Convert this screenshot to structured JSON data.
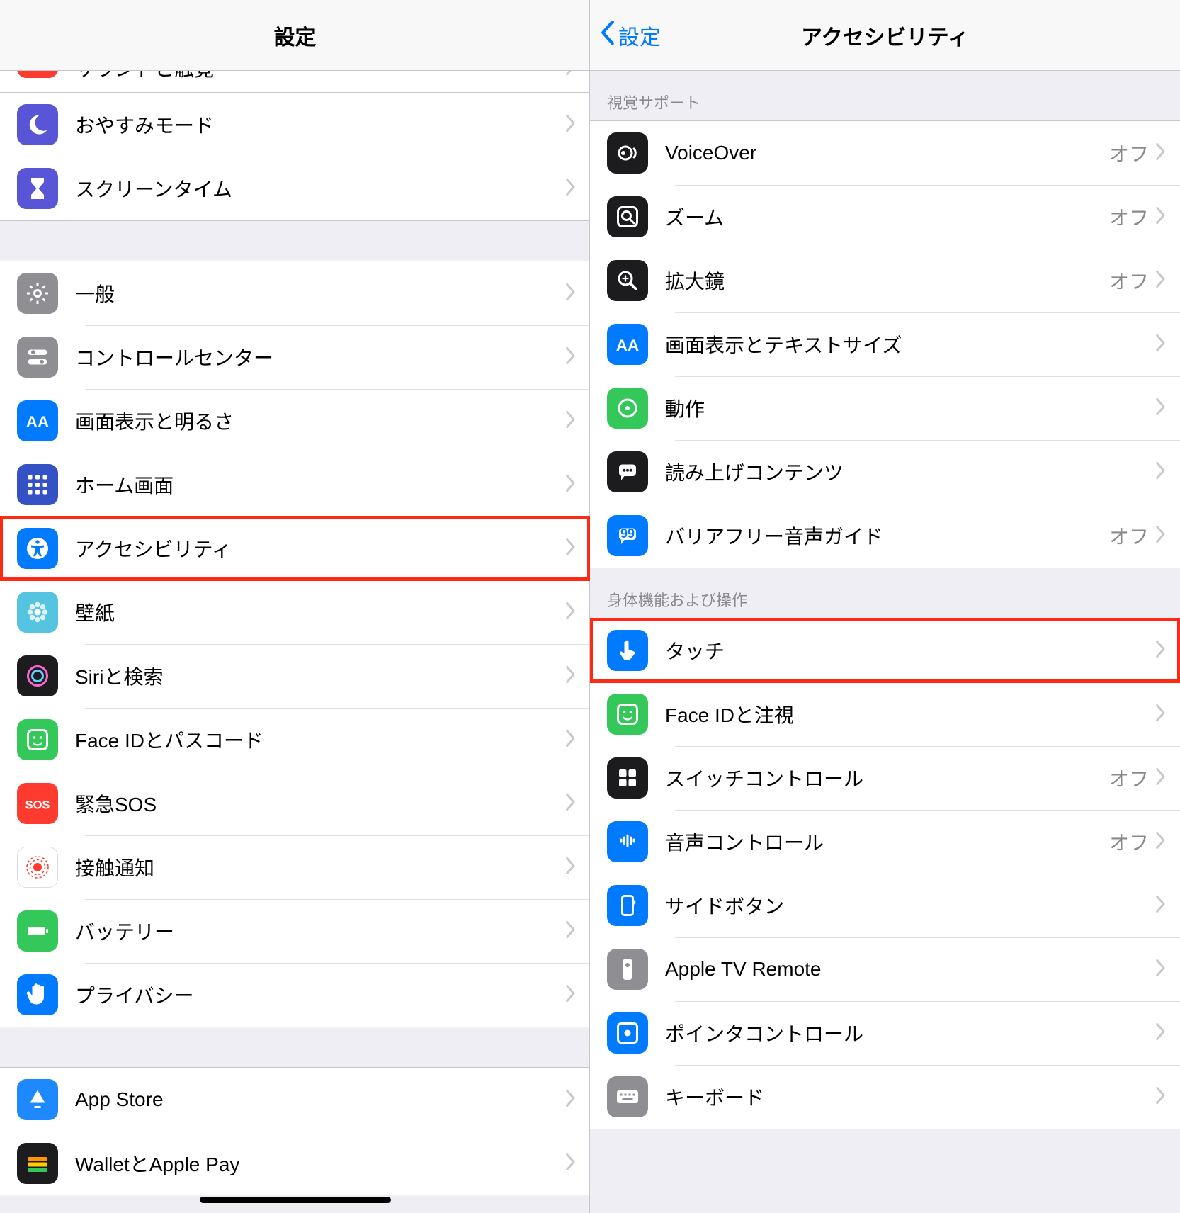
{
  "left": {
    "title": "設定",
    "cutoff_label": "サウンドと触覚",
    "groups": [
      {
        "items": [
          {
            "key": "dnd",
            "label": "おやすみモード",
            "icon_bg": "#5856d6",
            "icon": "moon"
          },
          {
            "key": "screentime",
            "label": "スクリーンタイム",
            "icon_bg": "#5856d6",
            "icon": "hourglass"
          }
        ]
      },
      {
        "items": [
          {
            "key": "general",
            "label": "一般",
            "icon_bg": "#8e8e93",
            "icon": "gear"
          },
          {
            "key": "controlcenter",
            "label": "コントロールセンター",
            "icon_bg": "#8e8e93",
            "icon": "switches"
          },
          {
            "key": "display",
            "label": "画面表示と明るさ",
            "icon_bg": "#007aff",
            "icon": "aa"
          },
          {
            "key": "home",
            "label": "ホーム画面",
            "icon_bg": "#3451c6",
            "icon": "grid"
          },
          {
            "key": "accessibility",
            "label": "アクセシビリティ",
            "icon_bg": "#007aff",
            "icon": "accessibility",
            "highlight": true
          },
          {
            "key": "wallpaper",
            "label": "壁紙",
            "icon_bg": "#54c4e0",
            "icon": "flower"
          },
          {
            "key": "siri",
            "label": "Siriと検索",
            "icon_bg": "#1c1c1e",
            "icon": "siri"
          },
          {
            "key": "faceid",
            "label": "Face IDとパスコード",
            "icon_bg": "#34c759",
            "icon": "face"
          },
          {
            "key": "sos",
            "label": "緊急SOS",
            "icon_bg": "#ff3b30",
            "icon": "sos"
          },
          {
            "key": "exposure",
            "label": "接触通知",
            "icon_bg": "#ffffff",
            "icon": "exposure"
          },
          {
            "key": "battery",
            "label": "バッテリー",
            "icon_bg": "#34c759",
            "icon": "battery"
          },
          {
            "key": "privacy",
            "label": "プライバシー",
            "icon_bg": "#007aff",
            "icon": "hand"
          }
        ]
      },
      {
        "items": [
          {
            "key": "appstore",
            "label": "App Store",
            "icon_bg": "#1e88ff",
            "icon": "appstore"
          },
          {
            "key": "wallet",
            "label": "WalletとApple Pay",
            "icon_bg": "#1c1c1e",
            "icon": "wallet"
          }
        ]
      }
    ]
  },
  "right": {
    "back_label": "設定",
    "title": "アクセシビリティ",
    "sections": [
      {
        "header": "視覚サポート",
        "items": [
          {
            "key": "voiceover",
            "label": "VoiceOver",
            "value": "オフ",
            "icon_bg": "#1c1c1e",
            "icon": "voiceover"
          },
          {
            "key": "zoom",
            "label": "ズーム",
            "value": "オフ",
            "icon_bg": "#1c1c1e",
            "icon": "zoom"
          },
          {
            "key": "magnifier",
            "label": "拡大鏡",
            "value": "オフ",
            "icon_bg": "#1c1c1e",
            "icon": "magnifier"
          },
          {
            "key": "textsize",
            "label": "画面表示とテキストサイズ",
            "icon_bg": "#007aff",
            "icon": "aa"
          },
          {
            "key": "motion",
            "label": "動作",
            "icon_bg": "#34c759",
            "icon": "motion"
          },
          {
            "key": "spoken",
            "label": "読み上げコンテンツ",
            "icon_bg": "#1c1c1e",
            "icon": "speech"
          },
          {
            "key": "audiodesc",
            "label": "バリアフリー音声ガイド",
            "value": "オフ",
            "icon_bg": "#007aff",
            "icon": "quote"
          }
        ]
      },
      {
        "header": "身体機能および操作",
        "items": [
          {
            "key": "touch",
            "label": "タッチ",
            "icon_bg": "#007aff",
            "icon": "touch",
            "highlight": true
          },
          {
            "key": "faceatt",
            "label": "Face IDと注視",
            "icon_bg": "#34c759",
            "icon": "face"
          },
          {
            "key": "switchctrl",
            "label": "スイッチコントロール",
            "value": "オフ",
            "icon_bg": "#1c1c1e",
            "icon": "switchctrl"
          },
          {
            "key": "voicectrl",
            "label": "音声コントロール",
            "value": "オフ",
            "icon_bg": "#007aff",
            "icon": "voicectrl"
          },
          {
            "key": "sidebutton",
            "label": "サイドボタン",
            "icon_bg": "#007aff",
            "icon": "sidebutton"
          },
          {
            "key": "appletv",
            "label": "Apple TV Remote",
            "icon_bg": "#8e8e93",
            "icon": "remote"
          },
          {
            "key": "pointer",
            "label": "ポインタコントロール",
            "icon_bg": "#007aff",
            "icon": "pointer"
          },
          {
            "key": "keyboard",
            "label": "キーボード",
            "icon_bg": "#8e8e93",
            "icon": "keyboard"
          }
        ]
      }
    ]
  }
}
